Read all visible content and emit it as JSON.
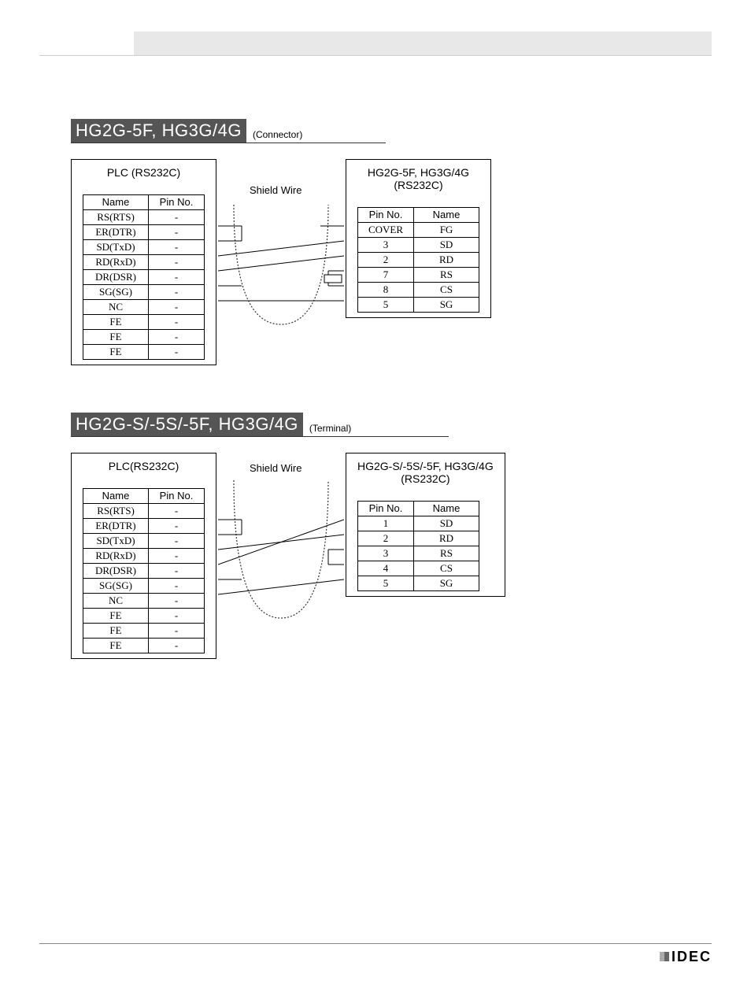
{
  "section1": {
    "badge": "HG2G-5F, HG3G/4G",
    "suffix": "(Connector)",
    "left_table": {
      "title": "PLC (RS232C)",
      "headers": [
        "Name",
        "Pin No."
      ],
      "rows": [
        [
          "RS(RTS)",
          "-"
        ],
        [
          "ER(DTR)",
          "-"
        ],
        [
          "SD(TxD)",
          "-"
        ],
        [
          "RD(RxD)",
          "-"
        ],
        [
          "DR(DSR)",
          "-"
        ],
        [
          "SG(SG)",
          "-"
        ],
        [
          "NC",
          "-"
        ],
        [
          "FE",
          "-"
        ],
        [
          "FE",
          "-"
        ],
        [
          "FE",
          "-"
        ]
      ]
    },
    "wire_label": "Shield Wire",
    "right_table": {
      "title_line1": "HG2G-5F, HG3G/4G",
      "title_line2": "(RS232C)",
      "headers": [
        "Pin No.",
        "Name"
      ],
      "rows": [
        [
          "COVER",
          "FG"
        ],
        [
          "3",
          "SD"
        ],
        [
          "2",
          "RD"
        ],
        [
          "7",
          "RS"
        ],
        [
          "8",
          "CS"
        ],
        [
          "5",
          "SG"
        ]
      ]
    }
  },
  "section2": {
    "badge": "HG2G-S/-5S/-5F, HG3G/4G",
    "suffix": "(Terminal)",
    "left_table": {
      "title": "PLC(RS232C)",
      "headers": [
        "Name",
        "Pin No."
      ],
      "rows": [
        [
          "RS(RTS)",
          "-"
        ],
        [
          "ER(DTR)",
          "-"
        ],
        [
          "SD(TxD)",
          "-"
        ],
        [
          "RD(RxD)",
          "-"
        ],
        [
          "DR(DSR)",
          "-"
        ],
        [
          "SG(SG)",
          "-"
        ],
        [
          "NC",
          "-"
        ],
        [
          "FE",
          "-"
        ],
        [
          "FE",
          "-"
        ],
        [
          "FE",
          "-"
        ]
      ]
    },
    "wire_label": "Shield Wire",
    "right_table": {
      "title_line1": "HG2G-S/-5S/-5F, HG3G/4G",
      "title_line2": "(RS232C)",
      "headers": [
        "Pin No.",
        "Name"
      ],
      "rows": [
        [
          "1",
          "SD"
        ],
        [
          "2",
          "RD"
        ],
        [
          "3",
          "RS"
        ],
        [
          "4",
          "CS"
        ],
        [
          "5",
          "SG"
        ]
      ]
    }
  },
  "footer": {
    "logo": "IDEC"
  }
}
